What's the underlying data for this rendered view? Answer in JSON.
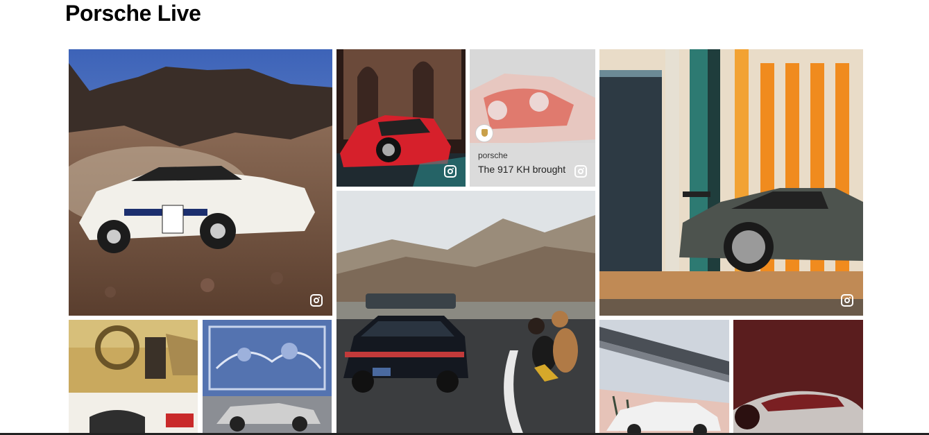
{
  "section": {
    "title": "Porsche Live"
  },
  "feed": {
    "posts": [
      {
        "name": "post-rally-959",
        "icon": "instagram-icon"
      },
      {
        "name": "post-red-cayman-castle",
        "icon": "instagram-icon"
      },
      {
        "name": "post-917-kh",
        "icon": "instagram-icon",
        "account": "porsche",
        "caption": "The 917 KH brought"
      },
      {
        "name": "post-gt2rs-stripes",
        "icon": "instagram-icon"
      },
      {
        "name": "post-911-dog-mountains"
      },
      {
        "name": "post-interior"
      },
      {
        "name": "post-turbo-tiles"
      },
      {
        "name": "post-taycan-bridge"
      },
      {
        "name": "post-red-illustration"
      }
    ]
  }
}
